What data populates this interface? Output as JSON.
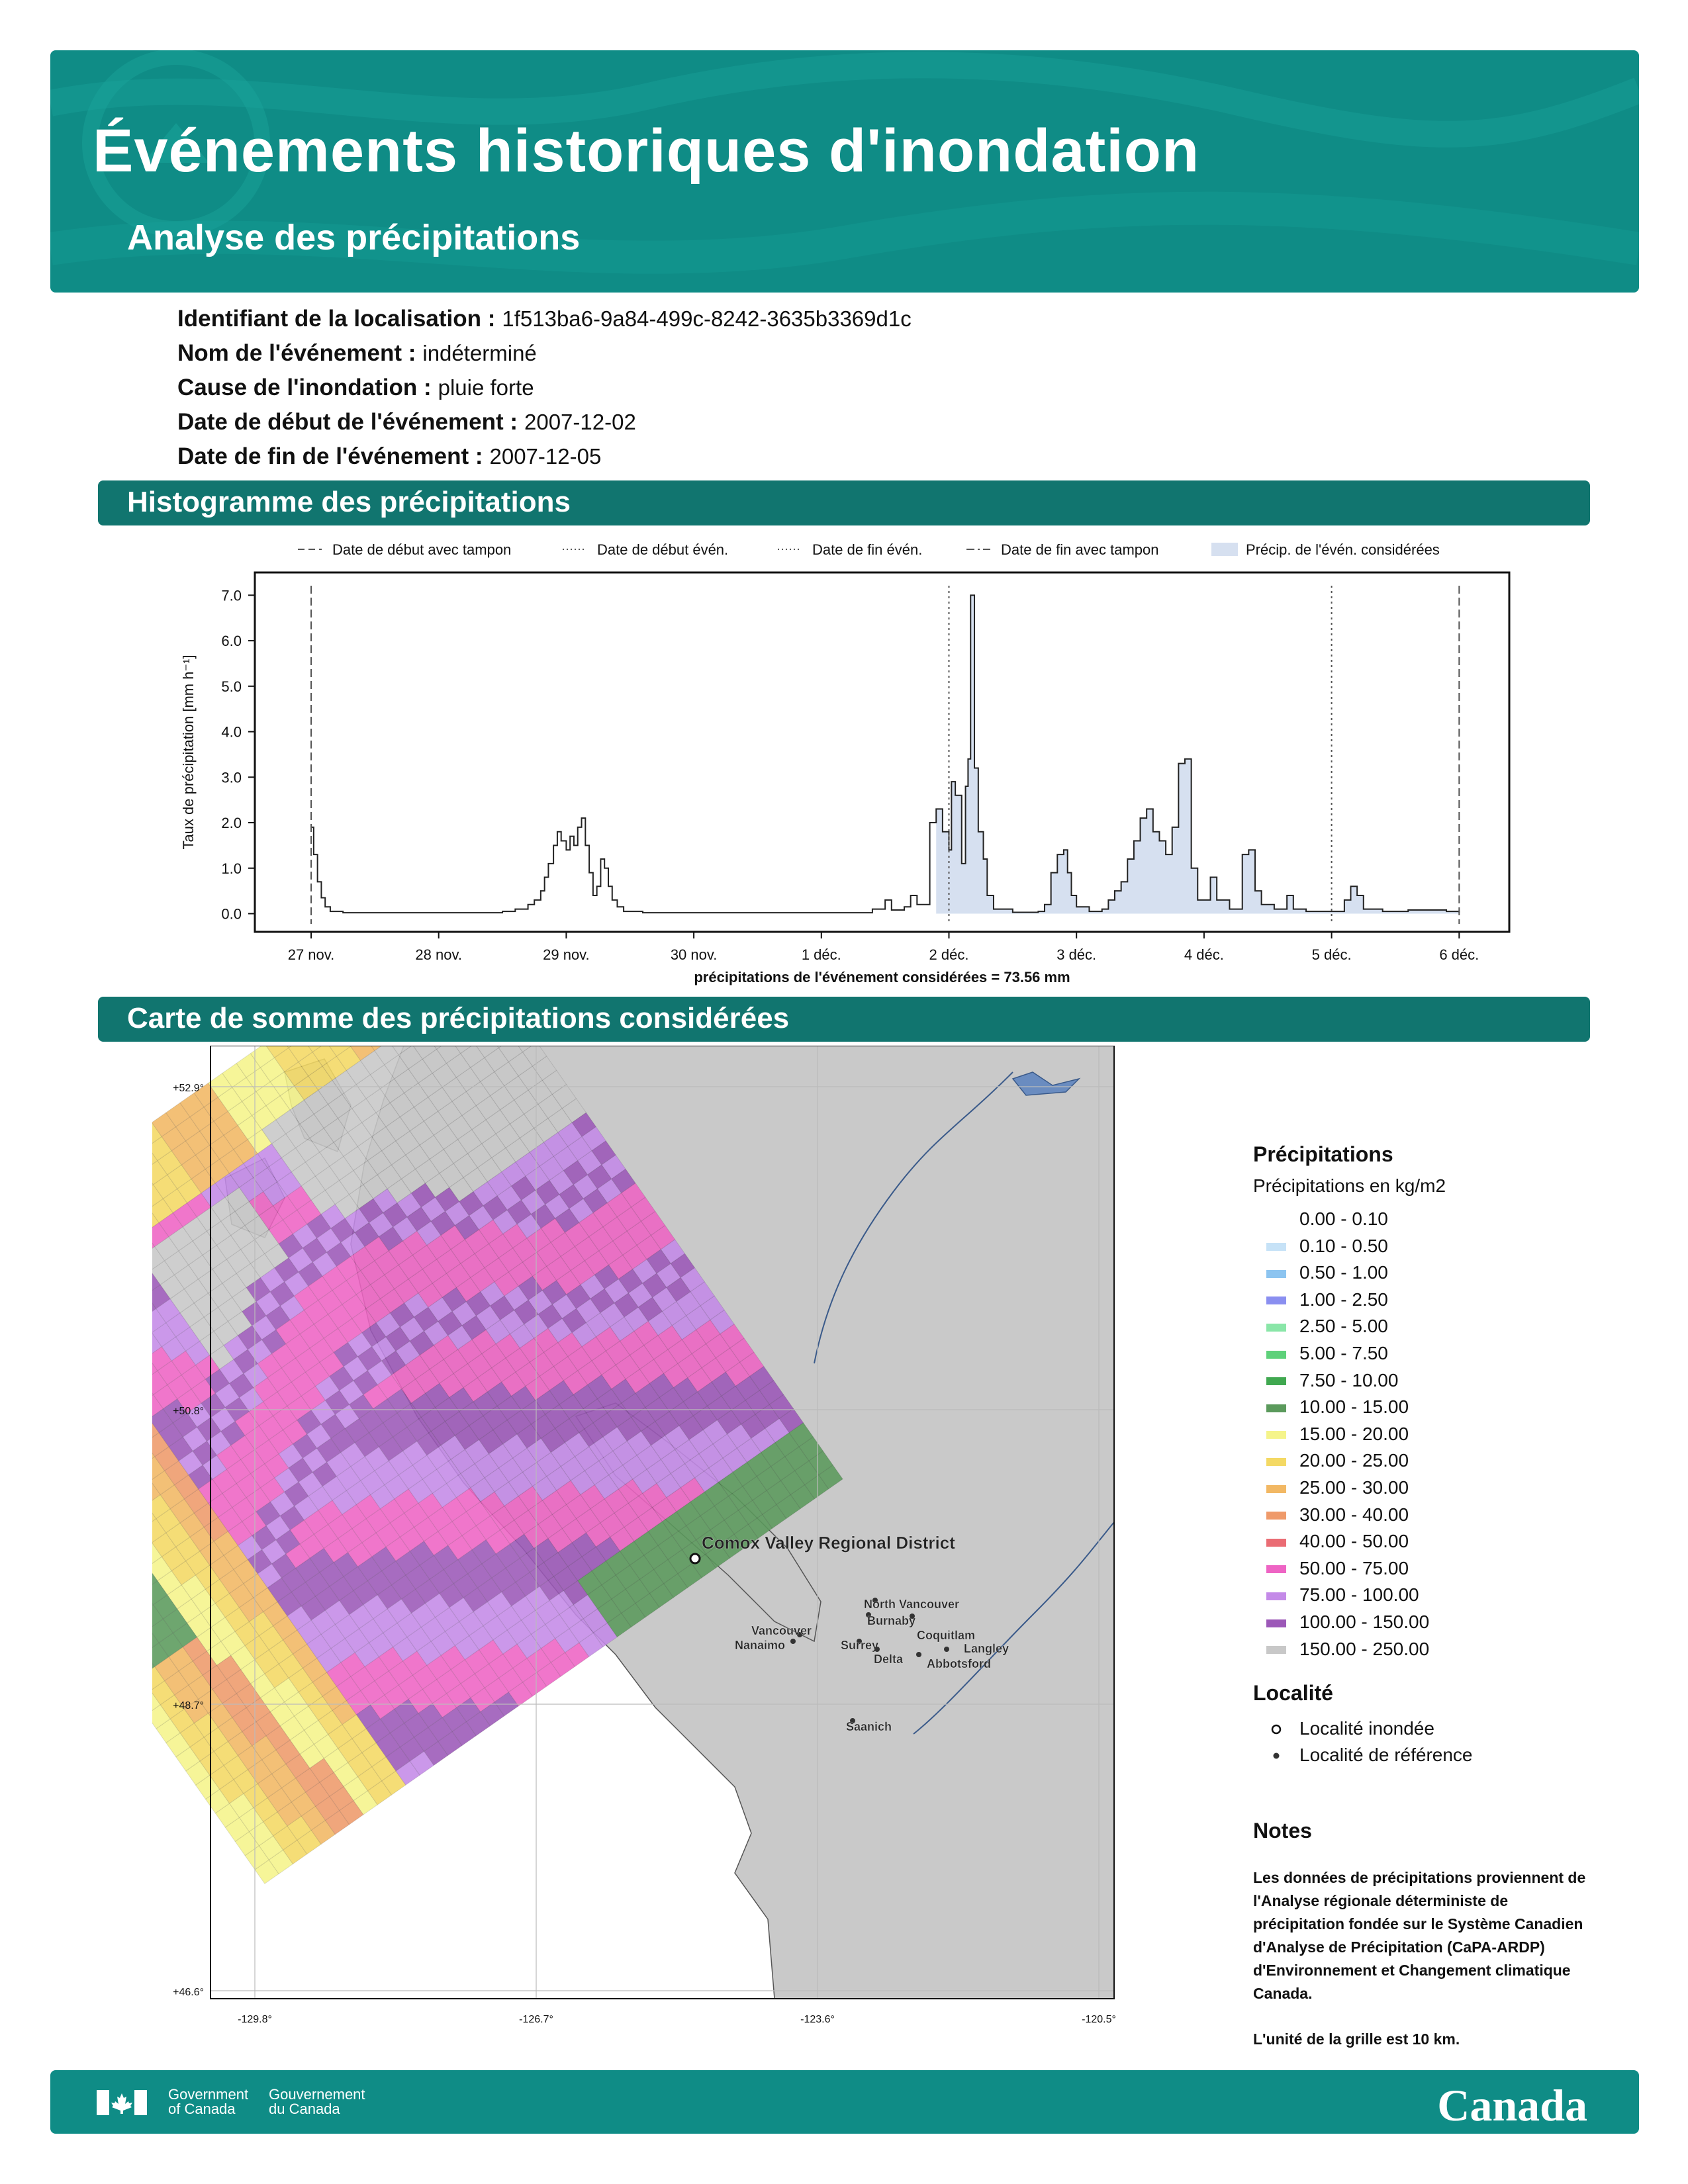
{
  "header": {
    "title": "Événements historiques d'inondation",
    "subtitle": "Analyse des précipitations"
  },
  "info": [
    {
      "label": "Identifiant de la localisation :",
      "value": "1f513ba6-9a84-499c-8242-3635b3369d1c"
    },
    {
      "label": "Nom de l'événement :",
      "value": "indéterminé"
    },
    {
      "label": "Cause de l'inondation :",
      "value": "pluie forte"
    },
    {
      "label": "Date de début de l'événement :",
      "value": "2007-12-02"
    },
    {
      "label": "Date de fin de l'événement :",
      "value": "2007-12-05"
    }
  ],
  "sections": {
    "histogram": "Histogramme des précipitations",
    "map": "Carte de somme des précipitations considérées"
  },
  "chart_data": {
    "type": "area",
    "ylabel": "Taux de précipitation [mm h⁻¹]",
    "xlabel": "précipitations de l'événement considérées = 73.56 mm",
    "x_unit": "days since 27 nov. 2007",
    "ylim": [
      -0.4,
      7.5
    ],
    "yticks": [
      "0.0",
      "1.0",
      "2.0",
      "3.0",
      "4.0",
      "5.0",
      "6.0",
      "7.0"
    ],
    "xticks": [
      "27 nov.",
      "28 nov.",
      "29 nov.",
      "30 nov.",
      "1 déc.",
      "2 déc.",
      "3 déc.",
      "4 déc.",
      "5 déc.",
      "6 déc."
    ],
    "legend": [
      "Date de début avec tampon",
      "Date de début évén.",
      "Date de fin évén.",
      "Date de fin avec tampon",
      "Précip. de l'évén. considérées"
    ],
    "fill_color": "#d6e0f0",
    "vlines": [
      {
        "name": "Date de début avec tampon",
        "date": "2007-11-27",
        "style": "dashed"
      },
      {
        "name": "Date de début évén.",
        "date": "2007-12-02",
        "style": "dotted"
      },
      {
        "name": "Date de fin évén.",
        "date": "2007-12-05",
        "style": "dotted"
      },
      {
        "name": "Date de fin avec tampon",
        "date": "2007-12-06",
        "style": "dashed"
      }
    ],
    "highlight_start": "2007-12-01 21:00",
    "highlight_end": "2007-12-06",
    "series": [
      {
        "name": "Taux de précipitation",
        "points": [
          [
            0.0,
            1.9
          ],
          [
            0.02,
            1.3
          ],
          [
            0.05,
            0.7
          ],
          [
            0.08,
            0.35
          ],
          [
            0.11,
            0.15
          ],
          [
            0.15,
            0.05
          ],
          [
            0.25,
            0.02
          ],
          [
            0.5,
            0.02
          ],
          [
            1.0,
            0.02
          ],
          [
            1.3,
            0.02
          ],
          [
            1.5,
            0.05
          ],
          [
            1.6,
            0.1
          ],
          [
            1.7,
            0.2
          ],
          [
            1.75,
            0.3
          ],
          [
            1.8,
            0.5
          ],
          [
            1.83,
            0.8
          ],
          [
            1.86,
            1.1
          ],
          [
            1.9,
            1.5
          ],
          [
            1.93,
            1.8
          ],
          [
            1.96,
            1.6
          ],
          [
            2.0,
            1.4
          ],
          [
            2.03,
            1.7
          ],
          [
            2.06,
            1.5
          ],
          [
            2.09,
            1.9
          ],
          [
            2.12,
            2.1
          ],
          [
            2.15,
            1.5
          ],
          [
            2.18,
            0.9
          ],
          [
            2.21,
            0.4
          ],
          [
            2.24,
            0.6
          ],
          [
            2.27,
            1.2
          ],
          [
            2.3,
            1.0
          ],
          [
            2.33,
            0.6
          ],
          [
            2.36,
            0.3
          ],
          [
            2.4,
            0.15
          ],
          [
            2.45,
            0.05
          ],
          [
            2.6,
            0.02
          ],
          [
            3.0,
            0.02
          ],
          [
            3.5,
            0.02
          ],
          [
            4.2,
            0.02
          ],
          [
            4.4,
            0.1
          ],
          [
            4.5,
            0.3
          ],
          [
            4.55,
            0.08
          ],
          [
            4.65,
            0.15
          ],
          [
            4.7,
            0.4
          ],
          [
            4.75,
            0.2
          ],
          [
            4.85,
            2.0
          ],
          [
            4.9,
            2.3
          ],
          [
            4.95,
            1.8
          ],
          [
            5.0,
            1.4
          ],
          [
            5.02,
            2.9
          ],
          [
            5.05,
            2.6
          ],
          [
            5.1,
            1.1
          ],
          [
            5.13,
            2.8
          ],
          [
            5.15,
            3.4
          ],
          [
            5.17,
            7.0
          ],
          [
            5.2,
            3.2
          ],
          [
            5.23,
            1.8
          ],
          [
            5.27,
            1.2
          ],
          [
            5.3,
            0.4
          ],
          [
            5.35,
            0.1
          ],
          [
            5.5,
            0.03
          ],
          [
            5.7,
            0.05
          ],
          [
            5.75,
            0.2
          ],
          [
            5.8,
            0.9
          ],
          [
            5.85,
            1.3
          ],
          [
            5.9,
            1.4
          ],
          [
            5.93,
            0.9
          ],
          [
            5.96,
            0.4
          ],
          [
            6.0,
            0.15
          ],
          [
            6.1,
            0.05
          ],
          [
            6.2,
            0.1
          ],
          [
            6.25,
            0.3
          ],
          [
            6.3,
            0.5
          ],
          [
            6.35,
            0.7
          ],
          [
            6.4,
            1.2
          ],
          [
            6.45,
            1.6
          ],
          [
            6.5,
            2.1
          ],
          [
            6.55,
            2.3
          ],
          [
            6.6,
            1.8
          ],
          [
            6.65,
            1.6
          ],
          [
            6.7,
            1.3
          ],
          [
            6.75,
            1.9
          ],
          [
            6.8,
            3.3
          ],
          [
            6.85,
            3.4
          ],
          [
            6.9,
            1.0
          ],
          [
            6.95,
            0.3
          ],
          [
            7.0,
            0.3
          ],
          [
            7.05,
            0.8
          ],
          [
            7.1,
            0.3
          ],
          [
            7.2,
            0.1
          ],
          [
            7.3,
            1.3
          ],
          [
            7.35,
            1.4
          ],
          [
            7.4,
            0.5
          ],
          [
            7.45,
            0.2
          ],
          [
            7.55,
            0.1
          ],
          [
            7.65,
            0.4
          ],
          [
            7.7,
            0.1
          ],
          [
            7.8,
            0.05
          ],
          [
            8.0,
            0.05
          ],
          [
            8.1,
            0.3
          ],
          [
            8.15,
            0.6
          ],
          [
            8.2,
            0.4
          ],
          [
            8.25,
            0.1
          ],
          [
            8.4,
            0.05
          ],
          [
            8.6,
            0.08
          ],
          [
            8.9,
            0.05
          ],
          [
            9.0,
            0.02
          ]
        ]
      }
    ]
  },
  "map": {
    "lat_labels": [
      "+52.9°",
      "+50.8°",
      "+48.7°",
      "+46.6°"
    ],
    "lon_labels": [
      "-129.8°",
      "-126.7°",
      "-123.6°",
      "-120.5°"
    ],
    "places": [
      {
        "name": "Comox Valley Regional District",
        "type": "flooded"
      },
      {
        "name": "North Vancouver",
        "type": "reference"
      },
      {
        "name": "Burnaby",
        "type": "reference"
      },
      {
        "name": "Vancouver",
        "type": "reference"
      },
      {
        "name": "Coquitlam",
        "type": "reference"
      },
      {
        "name": "Nanaimo",
        "type": "reference"
      },
      {
        "name": "Surrey",
        "type": "reference"
      },
      {
        "name": "Langley",
        "type": "reference"
      },
      {
        "name": "Delta",
        "type": "reference"
      },
      {
        "name": "Abbotsford",
        "type": "reference"
      },
      {
        "name": "Saanich",
        "type": "reference"
      }
    ]
  },
  "legend": {
    "title": "Précipitations",
    "subtitle": "Précipitations en kg/m2",
    "items": [
      {
        "label": "0.00 - 0.10",
        "color": "#ffffff"
      },
      {
        "label": "0.10 - 0.50",
        "color": "#c6e2f7"
      },
      {
        "label": "0.50 - 1.00",
        "color": "#8cc4f0"
      },
      {
        "label": "1.00 - 2.50",
        "color": "#8a8ff0"
      },
      {
        "label": "2.50 - 5.00",
        "color": "#8ae6a8"
      },
      {
        "label": "5.00 - 7.50",
        "color": "#5ed17a"
      },
      {
        "label": "7.50 - 10.00",
        "color": "#40a850"
      },
      {
        "label": "10.00 - 15.00",
        "color": "#5b9a5c"
      },
      {
        "label": "15.00 - 20.00",
        "color": "#f5f48a"
      },
      {
        "label": "20.00 - 25.00",
        "color": "#f4d964"
      },
      {
        "label": "25.00 - 30.00",
        "color": "#f2b864"
      },
      {
        "label": "30.00 - 40.00",
        "color": "#ef9a6a"
      },
      {
        "label": "40.00 - 50.00",
        "color": "#ea6c74"
      },
      {
        "label": "50.00 - 75.00",
        "color": "#ee64c4"
      },
      {
        "label": "75.00 - 100.00",
        "color": "#c48ae8"
      },
      {
        "label": "100.00 - 150.00",
        "color": "#9c58b8"
      },
      {
        "label": "150.00 - 250.00",
        "color": "#c8c8c8"
      }
    ]
  },
  "locality": {
    "title": "Localité",
    "flooded": "Localité inondée",
    "reference": "Localité de référence"
  },
  "notes": {
    "title": "Notes",
    "text": "Les données de précipitations proviennent de l'Analyse régionale déterministe de précipitation fondée sur le Système Canadien d'Analyse de Précipitation (CaPA-ARDP) d'Environnement et Changement climatique Canada.",
    "grid": "L'unité de la grille est 10 km."
  },
  "footer": {
    "gov_en_1": "Government",
    "gov_en_2": "of Canada",
    "gov_fr_1": "Gouvernement",
    "gov_fr_2": "du Canada",
    "wordmark": "Canada"
  }
}
